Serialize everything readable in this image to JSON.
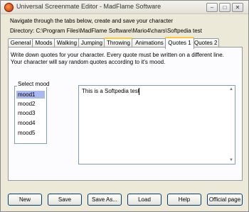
{
  "window": {
    "title": "Universal Screenmate Editor - MadFlame Software",
    "controls": {
      "minimize": "–",
      "maximize": "□",
      "close": "✕"
    }
  },
  "header": {
    "instruction": "Navigate through the tabs below, create and save your character",
    "directory_label": "Directory: C:\\Program Files\\MadFlame Software\\Mario4\\chars\\Softpedia test"
  },
  "tabs": [
    {
      "label": "General"
    },
    {
      "label": "Moods"
    },
    {
      "label": "Walking"
    },
    {
      "label": "Jumping"
    },
    {
      "label": "Throwing"
    },
    {
      "label": "Animations"
    },
    {
      "label": "Quotes 1"
    },
    {
      "label": "Quotes 2"
    }
  ],
  "active_tab": "Quotes 1",
  "panel": {
    "description_line1": "Write down quotes for your character. Every quote must be written on a different line.",
    "description_line2": "Your character will say random quotes according to it's mood.",
    "mood_group_label": "Select mood",
    "moods": [
      "mood1",
      "mood2",
      "mood3",
      "mood4",
      "mood5"
    ],
    "selected_mood": "mood1",
    "quote_text": "This is a Softpedia test"
  },
  "buttons": {
    "new": "New",
    "save": "Save",
    "save_as": "Save As...",
    "load": "Load",
    "help": "Help",
    "official_page": "Official page"
  },
  "colors": {
    "window_bg": "#ece9d8",
    "tab_highlight": "#ffc73c",
    "selection": "#aab8f0",
    "border_blue": "#7f9db9"
  }
}
